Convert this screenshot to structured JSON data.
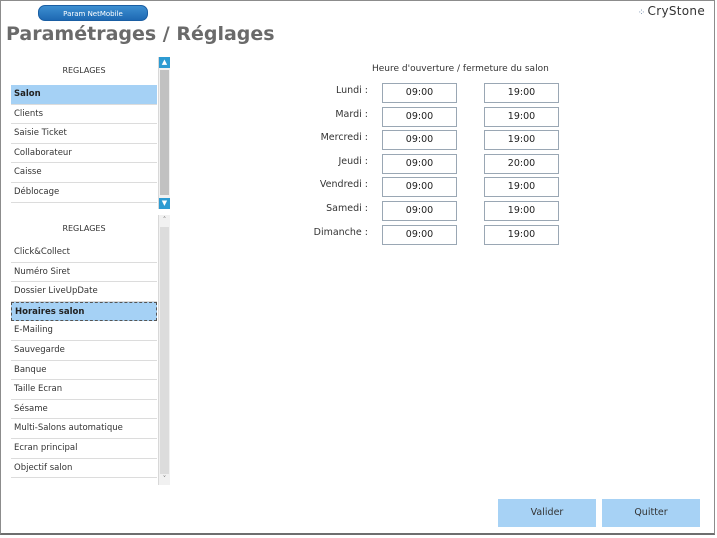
{
  "window": {
    "tab_label": "Param NetMobile",
    "brand": "CryStone",
    "title": "Paramétrages / Réglages"
  },
  "top_list": {
    "header": "REGLAGES",
    "items": [
      {
        "label": "Salon",
        "selected": true
      },
      {
        "label": "Clients",
        "selected": false
      },
      {
        "label": "Saisie Ticket",
        "selected": false
      },
      {
        "label": "Collaborateur",
        "selected": false
      },
      {
        "label": "Caisse",
        "selected": false
      },
      {
        "label": "Déblocage",
        "selected": false
      }
    ]
  },
  "bottom_list": {
    "header": "REGLAGES",
    "items": [
      {
        "label": "Click&Collect",
        "selected": false
      },
      {
        "label": "Numéro Siret",
        "selected": false
      },
      {
        "label": "Dossier LiveUpDate",
        "selected": false
      },
      {
        "label": "Horaires salon",
        "selected": true
      },
      {
        "label": "E-Mailing",
        "selected": false
      },
      {
        "label": "Sauvegarde",
        "selected": false
      },
      {
        "label": "Banque",
        "selected": false
      },
      {
        "label": "Taille Ecran",
        "selected": false
      },
      {
        "label": "Sésame",
        "selected": false
      },
      {
        "label": "Multi-Salons automatique",
        "selected": false
      },
      {
        "label": "Ecran principal",
        "selected": false
      },
      {
        "label": "Objectif salon",
        "selected": false
      }
    ]
  },
  "hours": {
    "title": "Heure d'ouverture / fermeture du salon",
    "days": [
      {
        "label": "Lundi :",
        "open": "09:00",
        "close": "19:00"
      },
      {
        "label": "Mardi :",
        "open": "09:00",
        "close": "19:00"
      },
      {
        "label": "Mercredi :",
        "open": "09:00",
        "close": "19:00"
      },
      {
        "label": "Jeudi :",
        "open": "09:00",
        "close": "20:00"
      },
      {
        "label": "Vendredi :",
        "open": "09:00",
        "close": "19:00"
      },
      {
        "label": "Samedi :",
        "open": "09:00",
        "close": "19:00"
      },
      {
        "label": "Dimanche :",
        "open": "09:00",
        "close": "19:00"
      }
    ]
  },
  "actions": {
    "validate": "Valider",
    "quit": "Quitter"
  }
}
